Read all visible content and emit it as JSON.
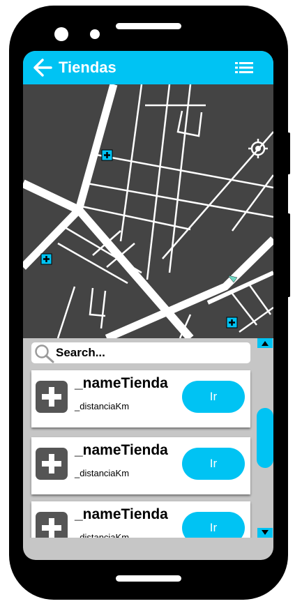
{
  "appbar": {
    "title": "Tiendas",
    "back_icon": "arrow-left-icon",
    "menu_icon": "list-icon",
    "color": "#00c3f3"
  },
  "map": {
    "locate_icon": "crosshair-icon",
    "marker_icon": "plus-marker-icon",
    "user_location_icon": "navigation-arrow-icon"
  },
  "search": {
    "placeholder": "Search..."
  },
  "stores": [
    {
      "name": "_nameTienda",
      "distance": "_distanciaKm",
      "button_label": "Ir"
    },
    {
      "name": "_nameTienda",
      "distance": "_distanciaKm",
      "button_label": "Ir"
    },
    {
      "name": "_nameTienda",
      "distance": "_distanciaKm",
      "button_label": "Ir"
    }
  ]
}
